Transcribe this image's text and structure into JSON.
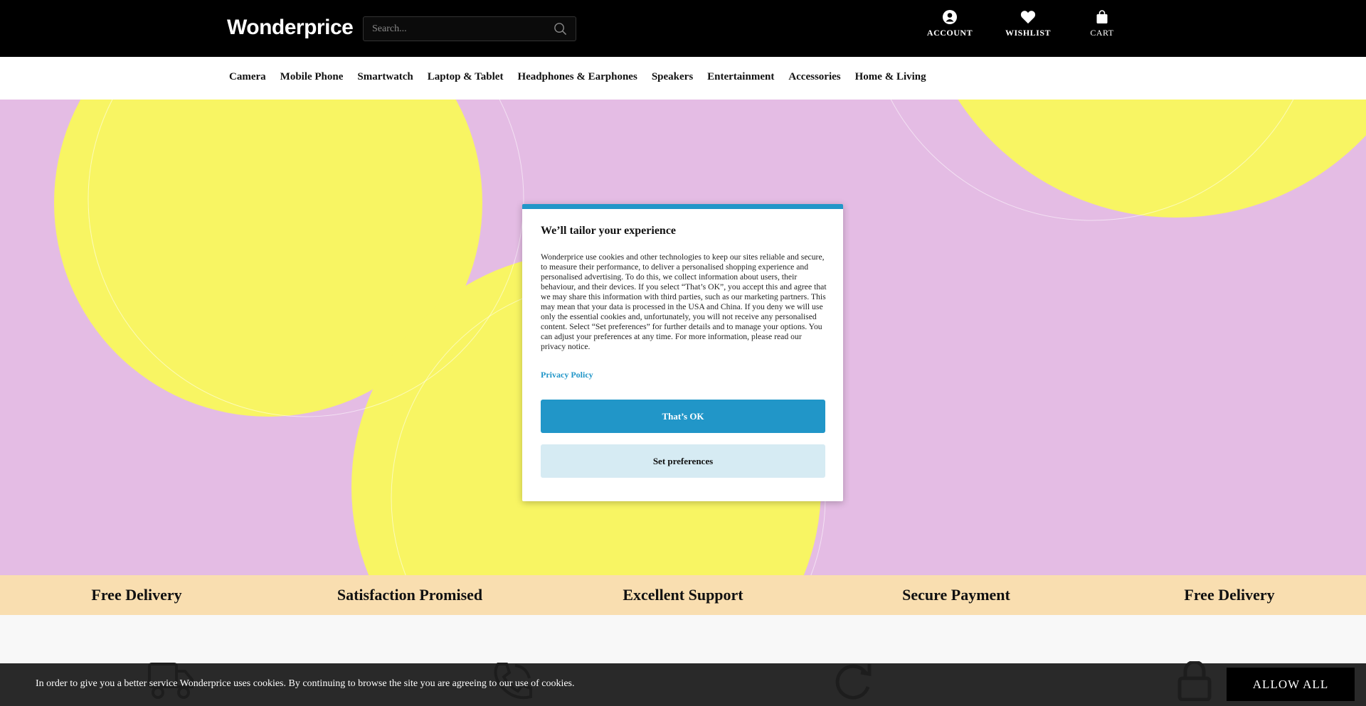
{
  "header": {
    "logo": "Wonderprice",
    "search_placeholder": "Search...",
    "account_label": "ACCOUNT",
    "wishlist_label": "WISHLIST",
    "cart_label": "CART"
  },
  "nav": {
    "items": [
      "Camera",
      "Mobile Phone",
      "Smartwatch",
      "Laptop & Tablet",
      "Headphones & Earphones",
      "Speakers",
      "Entertainment",
      "Accessories",
      "Home & Living"
    ]
  },
  "features": {
    "items": [
      "Free Delivery",
      "Satisfaction Promised",
      "Excellent Support",
      "Secure Payment",
      "Free Delivery"
    ]
  },
  "cookie_modal": {
    "title": "We’ll tailor your experience",
    "body": "Wonderprice use cookies and other technologies to keep our sites reliable and secure, to measure their performance, to deliver a personalised shopping experience and personalised advertising. To do this, we collect information about users, their behaviour, and their devices. If you select “That’s OK”, you accept this and agree that we may share this information with third parties, such as our marketing partners. This may mean that your data is processed in the USA and China. If you deny we will use only the essential cookies and, unfortunately, you will not receive any personalised content. Select “Set preferences” for further details and to manage your options. You can adjust your preferences at any time. For more information, please read our privacy notice.",
    "privacy_link": "Privacy Policy",
    "accept_label": "That’s OK",
    "preferences_label": "Set preferences"
  },
  "cookie_bar": {
    "text": "In order to give you a better service Wonderprice uses cookies. By continuing to browse the site you are agreeing to our use of cookies.",
    "allow_label": "ALLOW ALL"
  },
  "colors": {
    "hero_bg": "#e4bce4",
    "hero_circles": "#f8f563",
    "accent": "#2196c8",
    "feature_strip": "#f9deb0"
  }
}
